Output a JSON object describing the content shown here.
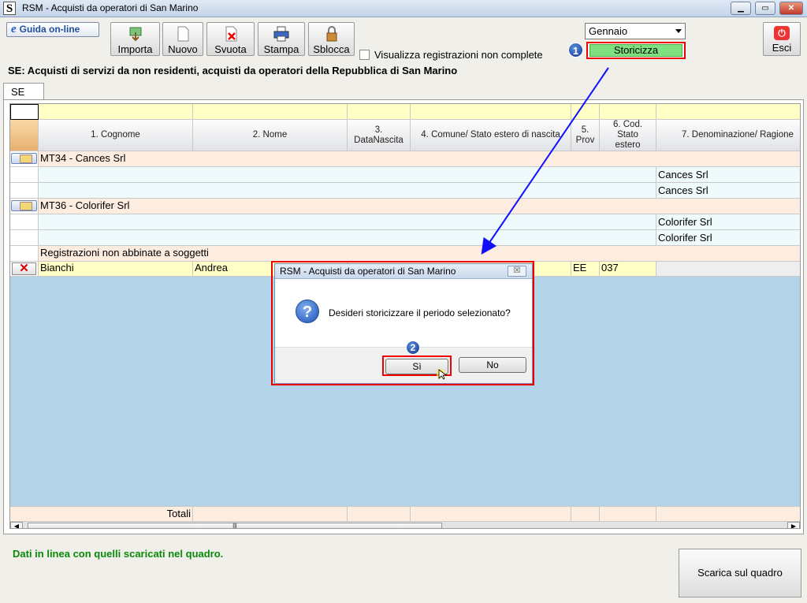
{
  "window": {
    "title": "RSM - Acquisti da operatori di San Marino",
    "icon_letter": "S"
  },
  "window_controls": {
    "minimize": "▁",
    "maximize": "▭",
    "close": "✕"
  },
  "toolbar": {
    "help_label": "Guida on-line",
    "help_icon": "e",
    "buttons": [
      {
        "label": "Importa",
        "icon": "import-icon"
      },
      {
        "label": "Nuovo",
        "icon": "new-document-icon"
      },
      {
        "label": "Svuota",
        "icon": "clear-icon"
      },
      {
        "label": "Stampa",
        "icon": "printer-icon"
      },
      {
        "label": "Sblocca",
        "icon": "lock-icon"
      }
    ],
    "checkbox_label": "Visualizza registrazioni non complete",
    "checkbox_checked": false,
    "month_value": "Gennaio",
    "storicizza_label": "Storicizza",
    "esci_label": "Esci",
    "esci_icon_glyph": "⏻"
  },
  "badges": {
    "one": "1",
    "two": "2"
  },
  "section_title": "SE: Acquisti di servizi da non residenti, acquisti da operatori della Repubblica di San Marino",
  "tab": "SE",
  "grid": {
    "columns": [
      "1. Cognome",
      "2. Nome",
      "3.\nDataNascita",
      "4. Comune/ Stato estero di nascita",
      "5.\nProv",
      "6. Cod.\nStato\nestero",
      "7. Denominazione/ Ragione"
    ],
    "groups": [
      {
        "name": "MT34 - Cances Srl",
        "rows": [
          "Cances Srl",
          "Cances Srl"
        ]
      },
      {
        "name": "MT36 - Colorifer Srl",
        "rows": [
          "Colorifer Srl",
          "Colorifer Srl"
        ]
      }
    ],
    "unmatched_label": "Registrazioni non abbinate a soggetti",
    "unmatched_row": {
      "cognome": "Bianchi",
      "nome": "Andrea",
      "prov": "EE",
      "cod_stato": "037"
    },
    "totals_label": "Totali",
    "scroll_thumb": "|||"
  },
  "status_text": "Dati in linea con quelli scaricati nel quadro.",
  "scarica_label": "Scarica sul quadro",
  "dialog": {
    "title": "RSM - Acquisti da operatori di San Marino",
    "message": "Desideri storicizzare il periodo selezionato?",
    "yes_label": "Sì",
    "no_label": "No",
    "close_glyph": "☒",
    "question_glyph": "?"
  },
  "colors": {
    "accent_red": "#e00000",
    "arrow_blue": "#1010ff",
    "status_green": "#0a8a0a",
    "grid_blue": "#b3d3e8"
  }
}
